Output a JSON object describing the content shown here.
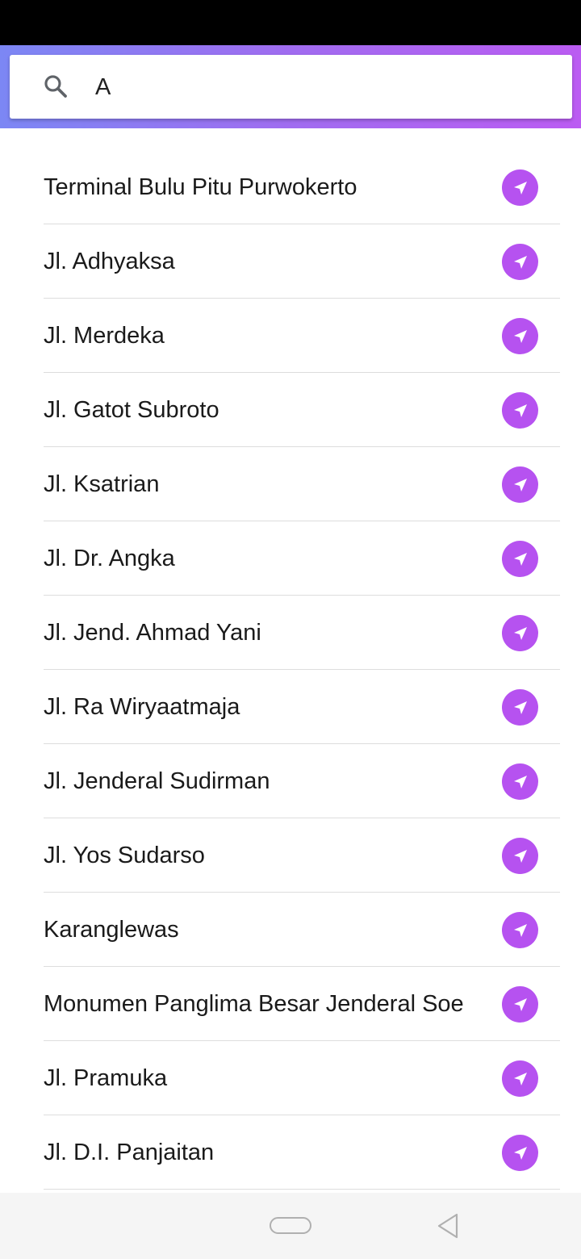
{
  "search": {
    "value": "A",
    "icon": "search-icon"
  },
  "colors": {
    "header_gradient_start": "#7c87f4",
    "header_gradient_end": "#bb5cf2",
    "nav_button": "#b652f0"
  },
  "results": [
    {
      "label": "Terminal Bulu Pitu Purwokerto"
    },
    {
      "label": "Jl. Adhyaksa"
    },
    {
      "label": "Jl. Merdeka"
    },
    {
      "label": "Jl. Gatot Subroto"
    },
    {
      "label": "Jl. Ksatrian"
    },
    {
      "label": "Jl. Dr. Angka"
    },
    {
      "label": "Jl. Jend. Ahmad Yani"
    },
    {
      "label": "Jl. Ra Wiryaatmaja"
    },
    {
      "label": "Jl. Jenderal Sudirman"
    },
    {
      "label": "Jl. Yos Sudarso"
    },
    {
      "label": "Karanglewas"
    },
    {
      "label": "Monumen Panglima Besar Jenderal Soe"
    },
    {
      "label": "Jl. Pramuka"
    },
    {
      "label": "Jl. D.I. Panjaitan"
    }
  ],
  "result_action_icon": "navigation-arrow-icon",
  "system_nav": {
    "home_icon": "home-pill-icon",
    "back_icon": "back-triangle-icon"
  }
}
